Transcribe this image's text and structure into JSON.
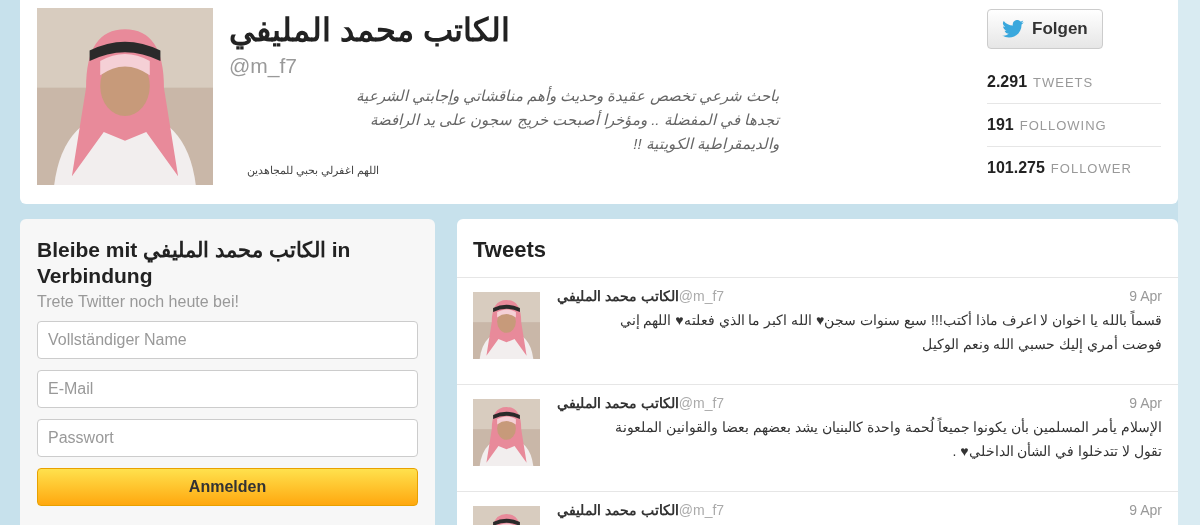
{
  "profile": {
    "name": "الكاتب محمد المليفي",
    "handle": "@m_f7",
    "bio_lines": [
      "باحث شرعي تخصص عقيدة وحديث وأهم مناقشاتي وإجابتي الشرعية",
      "تجدها في المفضلة .. ومؤخرا أصبحت خريج سجون على يد الرافضة",
      "والديمقراطية الكويتية !!"
    ],
    "location": "اللهم اغفرلي بحبي للمجاهدين"
  },
  "follow_button": "Folgen",
  "stats": [
    {
      "value": "2.291",
      "label": "TWEETS"
    },
    {
      "value": "191",
      "label": "FOLLOWING"
    },
    {
      "value": "101.275",
      "label": "FOLLOWER"
    }
  ],
  "signup": {
    "title_before": "Bleibe mit",
    "title_name": "الكاتب محمد المليفي",
    "title_after": "in Verbindung",
    "subtitle": "Trete Twitter noch heute bei!",
    "fields": [
      {
        "placeholder": "Vollständiger Name"
      },
      {
        "placeholder": "E-Mail"
      },
      {
        "placeholder": "Passwort"
      }
    ],
    "button": "Anmelden"
  },
  "tweets_title": "Tweets",
  "tweets": [
    {
      "name": "الكاتب محمد المليفي",
      "handle": "@m_f7",
      "date": "9 Apr",
      "lines": [
        "قسماً بالله يا اخوان لا اعرف ماذا أكتب!!! سبع سنوات سجن♥ الله اكبر ما الذي فعلته♥ اللهم إني",
        "فوضت أمري إليك حسبي الله ونعم الوكيل"
      ]
    },
    {
      "name": "الكاتب محمد المليفي",
      "handle": "@m_f7",
      "date": "9 Apr",
      "lines": [
        "الإسلام يأمر المسلمين بأن يكونوا جميعاً لُحمة واحدة كالبنيان يشد بعضهم بعضا والقوانين الملعونة",
        "تقول لا تتدخلوا في الشأن الداخلي♥ ."
      ]
    },
    {
      "name": "الكاتب محمد المليفي",
      "handle": "@m_f7",
      "date": "9 Apr"
    }
  ]
}
